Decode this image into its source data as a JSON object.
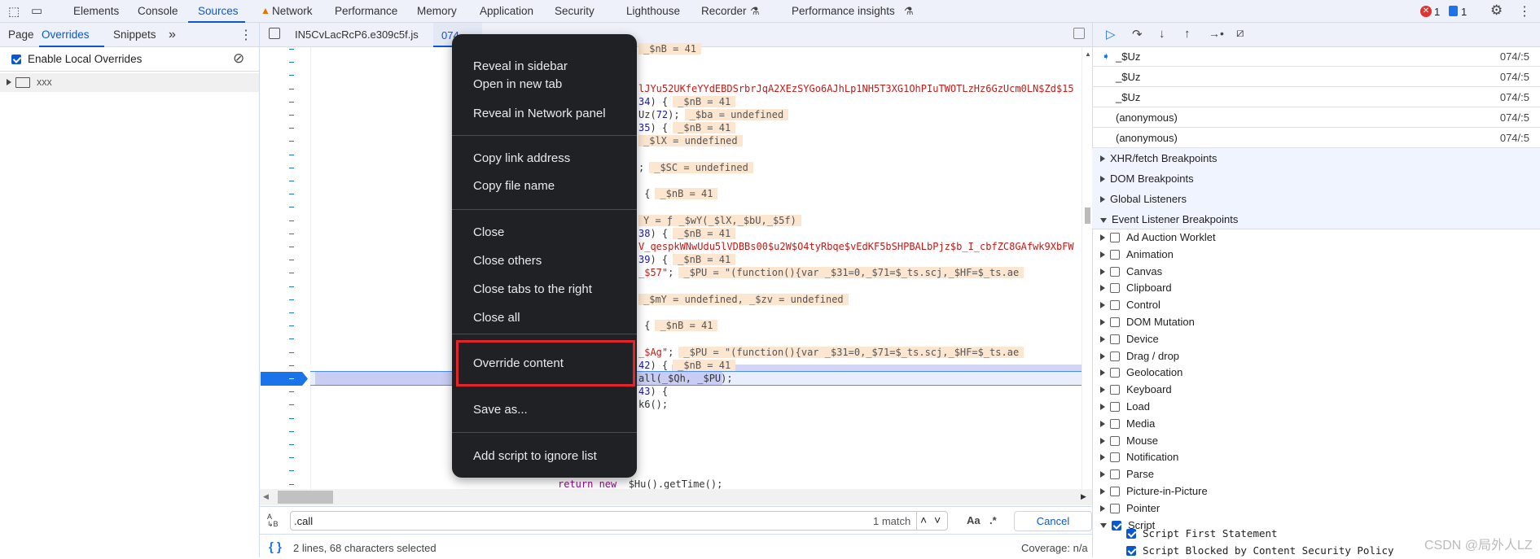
{
  "toolbar": {
    "tabs": [
      {
        "label": "Elements"
      },
      {
        "label": "Console"
      },
      {
        "label": "Sources"
      },
      {
        "label": "Network"
      },
      {
        "label": "Performance"
      },
      {
        "label": "Memory"
      },
      {
        "label": "Application"
      },
      {
        "label": "Security"
      },
      {
        "label": "Lighthouse"
      },
      {
        "label": "Recorder"
      },
      {
        "label": "Performance insights"
      }
    ],
    "active": "Sources",
    "errors": "1",
    "messages": "1"
  },
  "navigator": {
    "tabs": [
      {
        "label": "Page"
      },
      {
        "label": "Overrides"
      },
      {
        "label": "Snippets"
      }
    ],
    "more": "»",
    "enable_label": "Enable Local Overrides",
    "enable_checked": true,
    "folder": "xxx"
  },
  "editor": {
    "tabs": [
      {
        "label": "IN5CvLacRcP6.e309c5f.js"
      },
      {
        "label": "074"
      }
    ],
    "gutter_mark": "-",
    "lines": [
      {
        "i": 0,
        "tokens": [],
        "value": "_$nB = 41"
      },
      {
        "i": 3,
        "tokens": [
          {
            "t": "lJYu52UKfeYYdEBDSrbrJqA2XEzSYGo6AJhLp1NH5T3XG1OhPIuTWOTLzHz6GzUcm0LN$Zd$15",
            "c": "str"
          }
        ]
      },
      {
        "i": 4,
        "tokens": [
          {
            "t": "34",
            "c": "num"
          },
          {
            "t": ") {"
          }
        ],
        "value": "_$nB = 41"
      },
      {
        "i": 5,
        "tokens": [
          {
            "t": "Uz("
          },
          {
            "t": "72",
            "c": "num"
          },
          {
            "t": ");"
          }
        ],
        "value": "_$ba = undefined"
      },
      {
        "i": 6,
        "tokens": [
          {
            "t": "35",
            "c": "num"
          },
          {
            "t": ") {"
          }
        ],
        "value": "_$nB = 41"
      },
      {
        "i": 7,
        "tokens": [],
        "value": "_$lX = undefined"
      },
      {
        "i": 9,
        "tokens": [
          {
            "t": ";"
          }
        ],
        "value": "_$SC = undefined"
      },
      {
        "i": 11,
        "tokens": [
          {
            "t": " {"
          }
        ],
        "value": "_$nB = 41"
      },
      {
        "i": 13,
        "tokens": [],
        "value": "Y = ƒ _$wY(_$lX,_$bU,_$5f)"
      },
      {
        "i": 14,
        "tokens": [
          {
            "t": "38",
            "c": "num"
          },
          {
            "t": ") {"
          }
        ],
        "value": "_$nB = 41"
      },
      {
        "i": 15,
        "tokens": [
          {
            "t": "V_qespkWNwUdu5lVDBBs00$u2W$O4tyRbqe$vEdKF5bSHPBALbPjz$b_I_cbfZC8GAfwk9XbFW",
            "c": "str"
          }
        ]
      },
      {
        "i": 16,
        "tokens": [
          {
            "t": "39",
            "c": "num"
          },
          {
            "t": ") {"
          }
        ],
        "value": "_$nB = 41"
      },
      {
        "i": 17,
        "tokens": [
          {
            "t": "_$57\"",
            "c": "str"
          },
          {
            "t": ";"
          }
        ],
        "value": "_$PU = \"(function(){var _$31=0,_$71=$_ts.scj,_$HF=$_ts.ae"
      },
      {
        "i": 19,
        "tokens": [],
        "value": "_$mY = undefined, _$zv = undefined"
      },
      {
        "i": 21,
        "tokens": [
          {
            "t": " {"
          }
        ],
        "value": "_$nB = 41"
      },
      {
        "i": 23,
        "tokens": [
          {
            "t": "_$Ag\"",
            "c": "str"
          },
          {
            "t": ";"
          }
        ],
        "value": "_$PU = \"(function(){var _$31=0,_$71=$_ts.scj,_$HF=$_ts.ae"
      },
      {
        "i": 24,
        "tokens": [
          {
            "t": "42",
            "c": "num"
          },
          {
            "t": ") {"
          }
        ],
        "value": "_$nB = 41"
      },
      {
        "i": 25,
        "tokens": [
          {
            "t": "all(_$Qh, _$PU);"
          }
        ]
      },
      {
        "i": 26,
        "tokens": [
          {
            "t": "43",
            "c": "num"
          },
          {
            "t": ") {"
          }
        ]
      },
      {
        "i": 27,
        "tokens": [
          {
            "t": "k6();"
          }
        ]
      },
      {
        "i": 33,
        "tokens": [
          {
            "t": "return new",
            "c": "kw"
          },
          {
            "t": " _$Hu().getTime();"
          }
        ]
      }
    ]
  },
  "context_menu": {
    "groups": [
      [
        "Reveal in sidebar",
        "Open in new tab",
        "Reveal in Network panel"
      ],
      [
        "Copy link address",
        "Copy file name"
      ],
      [
        "Close",
        "Close others",
        "Close tabs to the right",
        "Close all"
      ],
      [
        "Override content"
      ],
      [
        "Save as..."
      ],
      [
        "Add script to ignore list"
      ]
    ],
    "highlighted": "Override content",
    "highlight_color": "#e3242b"
  },
  "search": {
    "value": ".call",
    "matches": "1 match",
    "case_label": "Aa",
    "regex_label": ".*",
    "cancel": "Cancel"
  },
  "status": {
    "selection": "2 lines, 68 characters selected",
    "coverage": "Coverage: n/a"
  },
  "call_stack": [
    {
      "name": "_$Uz",
      "loc": "074/:5",
      "current": true
    },
    {
      "name": "_$Uz",
      "loc": "074/:5"
    },
    {
      "name": "_$Uz",
      "loc": "074/:5"
    },
    {
      "name": "(anonymous)",
      "loc": "074/:5"
    },
    {
      "name": "(anonymous)",
      "loc": "074/:5"
    }
  ],
  "sections": [
    {
      "label": "XHR/fetch Breakpoints",
      "open": false
    },
    {
      "label": "DOM Breakpoints",
      "open": false
    },
    {
      "label": "Global Listeners",
      "open": false
    },
    {
      "label": "Event Listener Breakpoints",
      "open": true
    }
  ],
  "event_listeners": [
    {
      "label": "Ad Auction Worklet",
      "checked": false
    },
    {
      "label": "Animation",
      "checked": false
    },
    {
      "label": "Canvas",
      "checked": false
    },
    {
      "label": "Clipboard",
      "checked": false
    },
    {
      "label": "Control",
      "checked": false
    },
    {
      "label": "DOM Mutation",
      "checked": false
    },
    {
      "label": "Device",
      "checked": false
    },
    {
      "label": "Drag / drop",
      "checked": false
    },
    {
      "label": "Geolocation",
      "checked": false
    },
    {
      "label": "Keyboard",
      "checked": false
    },
    {
      "label": "Load",
      "checked": false
    },
    {
      "label": "Media",
      "checked": false
    },
    {
      "label": "Mouse",
      "checked": false
    },
    {
      "label": "Notification",
      "checked": false
    },
    {
      "label": "Parse",
      "checked": false
    },
    {
      "label": "Picture-in-Picture",
      "checked": false
    },
    {
      "label": "Pointer",
      "checked": false
    },
    {
      "label": "Script",
      "checked": true,
      "open": true
    }
  ],
  "script_children": [
    {
      "label": "Script First Statement",
      "checked": true
    },
    {
      "label": "Script Blocked by Content Security Policy",
      "checked": true
    }
  ],
  "watermark": "CSDN @局外人LZ",
  "colors": {
    "accent": "#0b57d0",
    "error": "#dc362e",
    "menu_bg": "#202124",
    "inline_value_bg": "#fde6d0"
  }
}
